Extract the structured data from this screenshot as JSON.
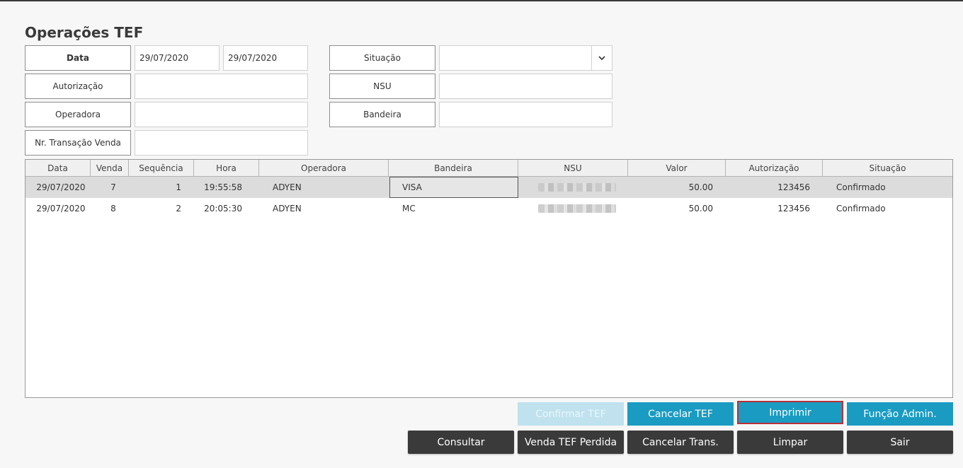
{
  "title": "Operações TEF",
  "filters": {
    "data_label": "Data",
    "data_from": "29/07/2020",
    "data_to": "29/07/2020",
    "autorizacao_label": "Autorização",
    "autorizacao_value": "",
    "operadora_label": "Operadora",
    "operadora_value": "",
    "transacao_label": "Nr. Transação Venda",
    "transacao_value": "",
    "situacao_label": "Situação",
    "situacao_value": "",
    "nsu_label": "NSU",
    "nsu_value": "",
    "bandeira_label": "Bandeira",
    "bandeira_value": ""
  },
  "grid": {
    "columns": [
      "Data",
      "Venda",
      "Sequência",
      "Hora",
      "Operadora",
      "Bandeira",
      "NSU",
      "Valor",
      "Autorização",
      "Situação"
    ],
    "rows": [
      {
        "data": "29/07/2020",
        "venda": "7",
        "sequencia": "1",
        "hora": "19:55:58",
        "operadora": "ADYEN",
        "bandeira": "VISA",
        "valor": "50.00",
        "autorizacao": "123456",
        "situacao": "Confirmado"
      },
      {
        "data": "29/07/2020",
        "venda": "8",
        "sequencia": "2",
        "hora": "20:05:30",
        "operadora": "ADYEN",
        "bandeira": "MC",
        "valor": "50.00",
        "autorizacao": "123456",
        "situacao": "Confirmado"
      }
    ]
  },
  "buttons": {
    "confirmar_tef": "Confirmar TEF",
    "cancelar_tef": "Cancelar TEF",
    "imprimir": "Imprimir",
    "funcao_admin": "Função Admin.",
    "consultar": "Consultar",
    "venda_tef_perdida": "Venda TEF Perdida",
    "cancelar_trans": "Cancelar Trans.",
    "limpar": "Limpar",
    "sair": "Sair"
  },
  "icons": {
    "situacao_dropdown": "chevron-down-icon"
  },
  "colors": {
    "accent": "#1a9bc2",
    "dark_button": "#3a3a3a",
    "focus_border": "#b8303a"
  }
}
